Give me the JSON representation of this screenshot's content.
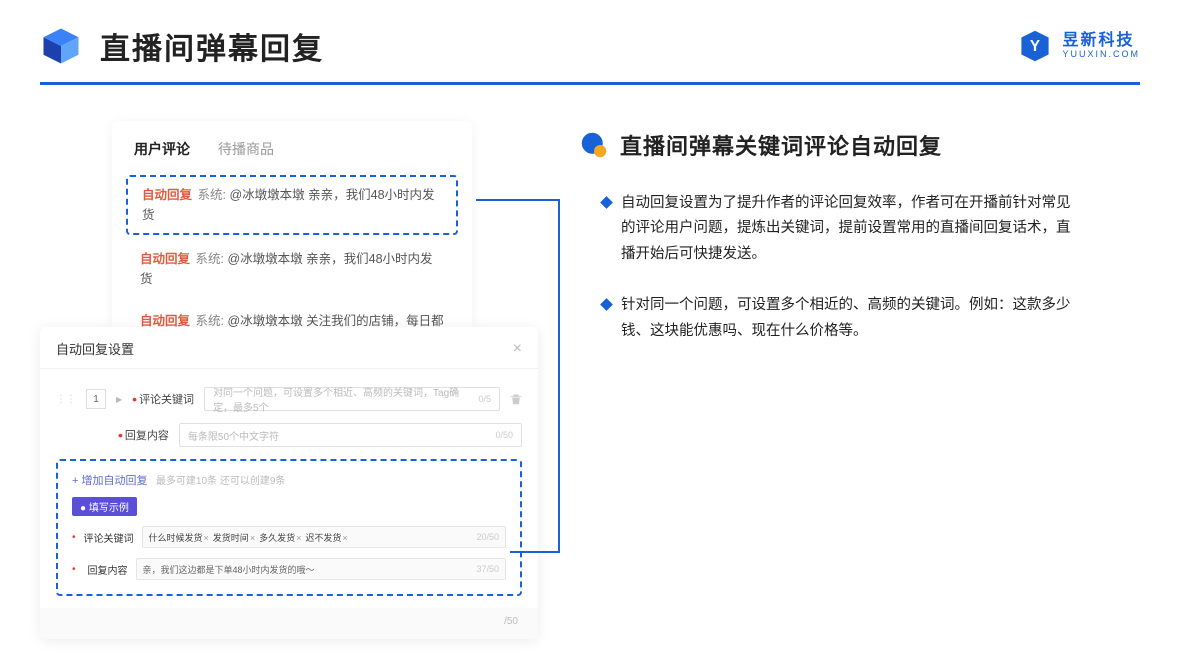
{
  "header": {
    "title": "直播间弹幕回复",
    "brand_cn": "昱新科技",
    "brand_en": "YUUXIN.COM"
  },
  "comments_card": {
    "tabs": {
      "active": "用户评论",
      "inactive": "待播商品"
    },
    "rows": [
      {
        "tag": "自动回复",
        "sys": "系统:",
        "text": "@冰墩墩本墩 亲亲，我们48小时内发货",
        "highlight": true
      },
      {
        "tag": "自动回复",
        "sys": "系统:",
        "text": "@冰墩墩本墩 亲亲，我们48小时内发货",
        "highlight": false
      },
      {
        "tag": "自动回复",
        "sys": "系统:",
        "text": "@冰墩墩本墩 关注我们的店铺，每日都有热门推荐呦～",
        "highlight": false
      }
    ]
  },
  "settings_card": {
    "title": "自动回复设置",
    "row_num": "1",
    "keyword_label": "评论关键词",
    "keyword_placeholder": "对同一个问题，可设置多个相近、高频的关键词，Tag确定，最多5个",
    "keyword_counter": "0/5",
    "reply_label": "回复内容",
    "reply_placeholder": "每条限50个中文字符",
    "reply_counter": "0/50",
    "add_link": "+ 增加自动回复",
    "add_hint": "最多可建10条 还可以创建9条",
    "badge": "● 填写示例",
    "ex_keyword_label": "评论关键词",
    "ex_chips": [
      "什么时候发货",
      "发货时间",
      "多久发货",
      "迟不发货"
    ],
    "ex_keyword_counter": "20/50",
    "ex_reply_label": "回复内容",
    "ex_reply_text": "亲，我们这边都是下单48小时内发货的哦～",
    "ex_reply_counter": "37/50",
    "foot_counter": "/50"
  },
  "right": {
    "subtitle": "直播间弹幕关键词评论自动回复",
    "bullets": [
      "自动回复设置为了提升作者的评论回复效率，作者可在开播前针对常见的评论用户问题，提炼出关键词，提前设置常用的直播间回复话术，直播开始后可快捷发送。",
      "针对同一个问题，可设置多个相近的、高频的关键词。例如：这款多少钱、这块能优惠吗、现在什么价格等。"
    ]
  }
}
